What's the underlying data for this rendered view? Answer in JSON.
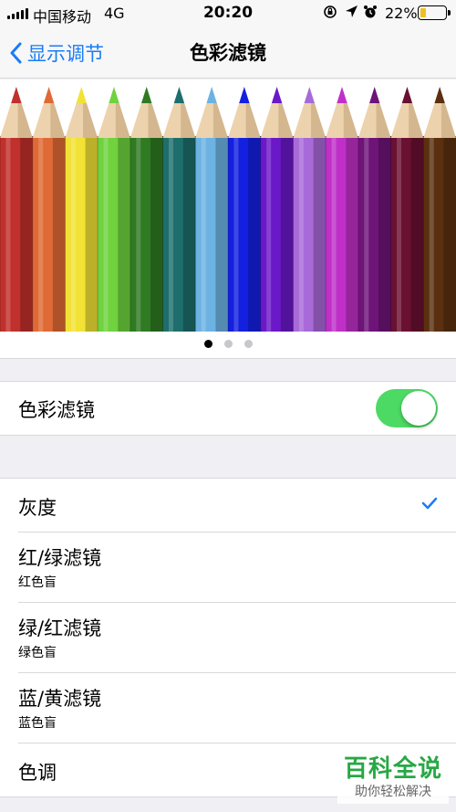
{
  "status_bar": {
    "carrier": "中国移动",
    "network": "4G",
    "time": "20:20",
    "battery": "22%",
    "battery_level": 0.22,
    "icons": [
      "signal-icon",
      "orientation-lock-icon",
      "location-icon",
      "alarm-icon",
      "battery-icon"
    ]
  },
  "nav": {
    "back_label": "显示调节",
    "title": "色彩滤镜"
  },
  "preview": {
    "pencil_colors": [
      "#c0302c",
      "#e06a35",
      "#f2e235",
      "#6fd23e",
      "#2f7a22",
      "#1e6e6e",
      "#6cb3e3",
      "#1420e0",
      "#6a18c8",
      "#a86ad8",
      "#c030c8",
      "#6e1478",
      "#6a1030",
      "#5a3010"
    ],
    "pages": 3,
    "active_page": 1
  },
  "toggle": {
    "label": "色彩滤镜",
    "on": true,
    "on_color": "#4cd964"
  },
  "filters": [
    {
      "title": "灰度",
      "subtitle": "",
      "selected": true
    },
    {
      "title": "红/绿滤镜",
      "subtitle": "红色盲",
      "selected": false
    },
    {
      "title": "绿/红滤镜",
      "subtitle": "绿色盲",
      "selected": false
    },
    {
      "title": "蓝/黄滤镜",
      "subtitle": "蓝色盲",
      "selected": false
    },
    {
      "title": "色调",
      "subtitle": "",
      "selected": false
    }
  ],
  "accent_color": "#1a7cf5",
  "watermark": {
    "logo": "百科全说",
    "slogan": "助你轻松解决"
  }
}
